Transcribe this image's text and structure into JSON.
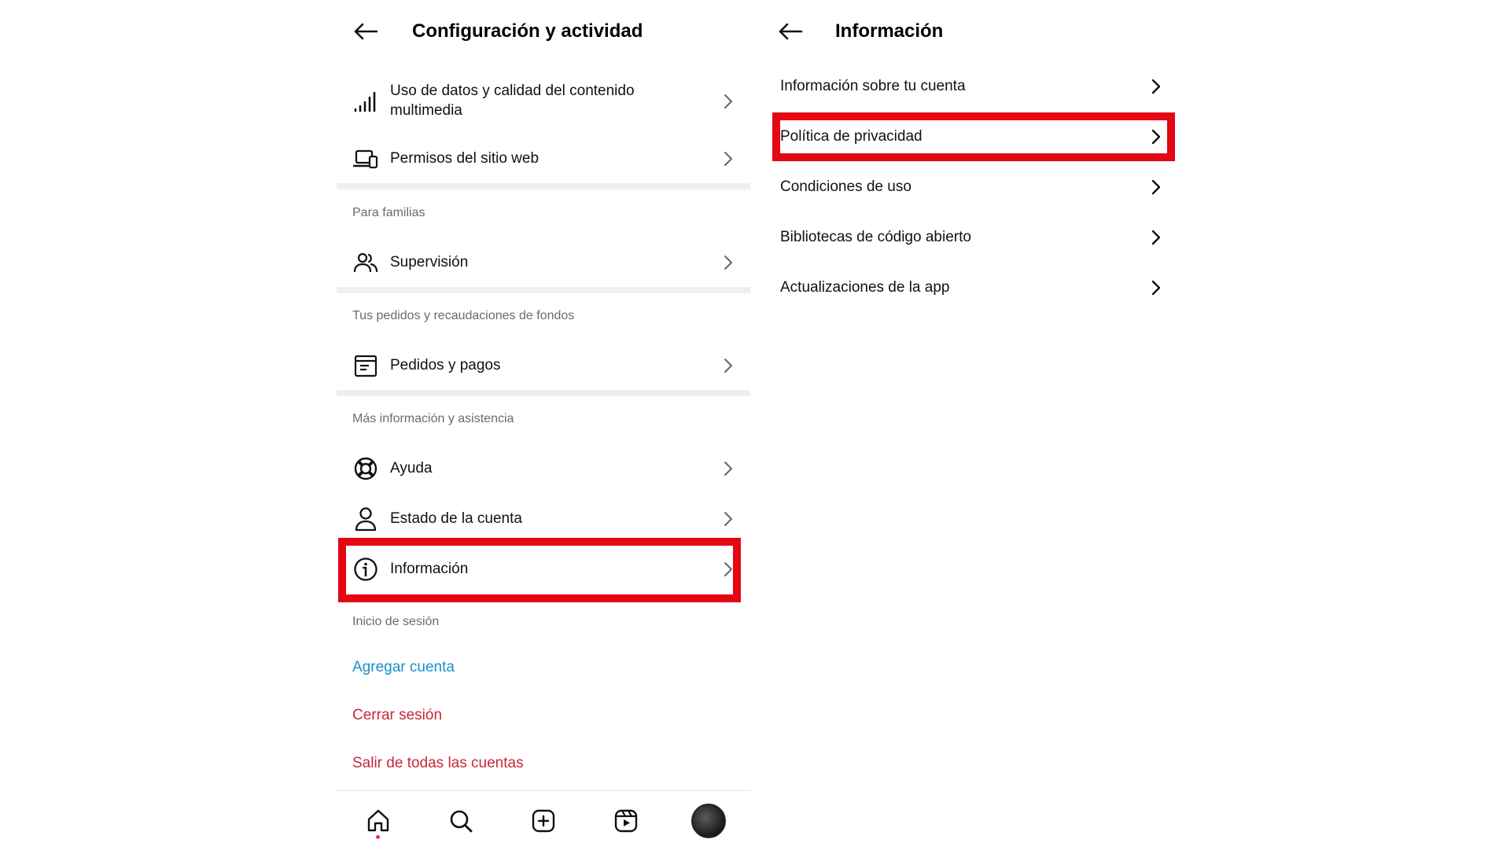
{
  "left": {
    "title": "Configuración y actividad",
    "items": [
      {
        "label": "Uso de datos y calidad del contenido multimedia",
        "icon": "signal-bars-icon"
      },
      {
        "label": "Permisos del sitio web",
        "icon": "devices-icon"
      }
    ],
    "families": {
      "section_label": "Para familias",
      "items": [
        {
          "label": "Supervisión",
          "icon": "people-icon"
        }
      ]
    },
    "orders": {
      "section_label": "Tus pedidos y recaudaciones de fondos",
      "items": [
        {
          "label": "Pedidos y pagos",
          "icon": "receipt-icon"
        }
      ]
    },
    "support": {
      "section_label": "Más información y asistencia",
      "items": [
        {
          "label": "Ayuda",
          "icon": "lifebuoy-icon"
        },
        {
          "label": "Estado de la cuenta",
          "icon": "person-icon"
        },
        {
          "label": "Información",
          "icon": "info-icon"
        }
      ]
    },
    "login": {
      "section_label": "Inicio de sesión",
      "add_account": "Agregar cuenta",
      "logout": "Cerrar sesión",
      "logout_all": "Salir de todas las cuentas"
    },
    "bottom_nav": [
      "home-icon",
      "search-icon",
      "create-icon",
      "reels-icon",
      "profile-avatar"
    ]
  },
  "right": {
    "title": "Información",
    "items": [
      {
        "label": "Información sobre tu cuenta"
      },
      {
        "label": "Política de privacidad"
      },
      {
        "label": "Condiciones de uso"
      },
      {
        "label": "Bibliotecas de código abierto"
      },
      {
        "label": "Actualizaciones de la app"
      }
    ]
  },
  "colors": {
    "highlight": "#e30613",
    "link_blue": "#1a8fc9",
    "danger_red": "#c8283a",
    "section_gray": "#6b6b6b"
  }
}
